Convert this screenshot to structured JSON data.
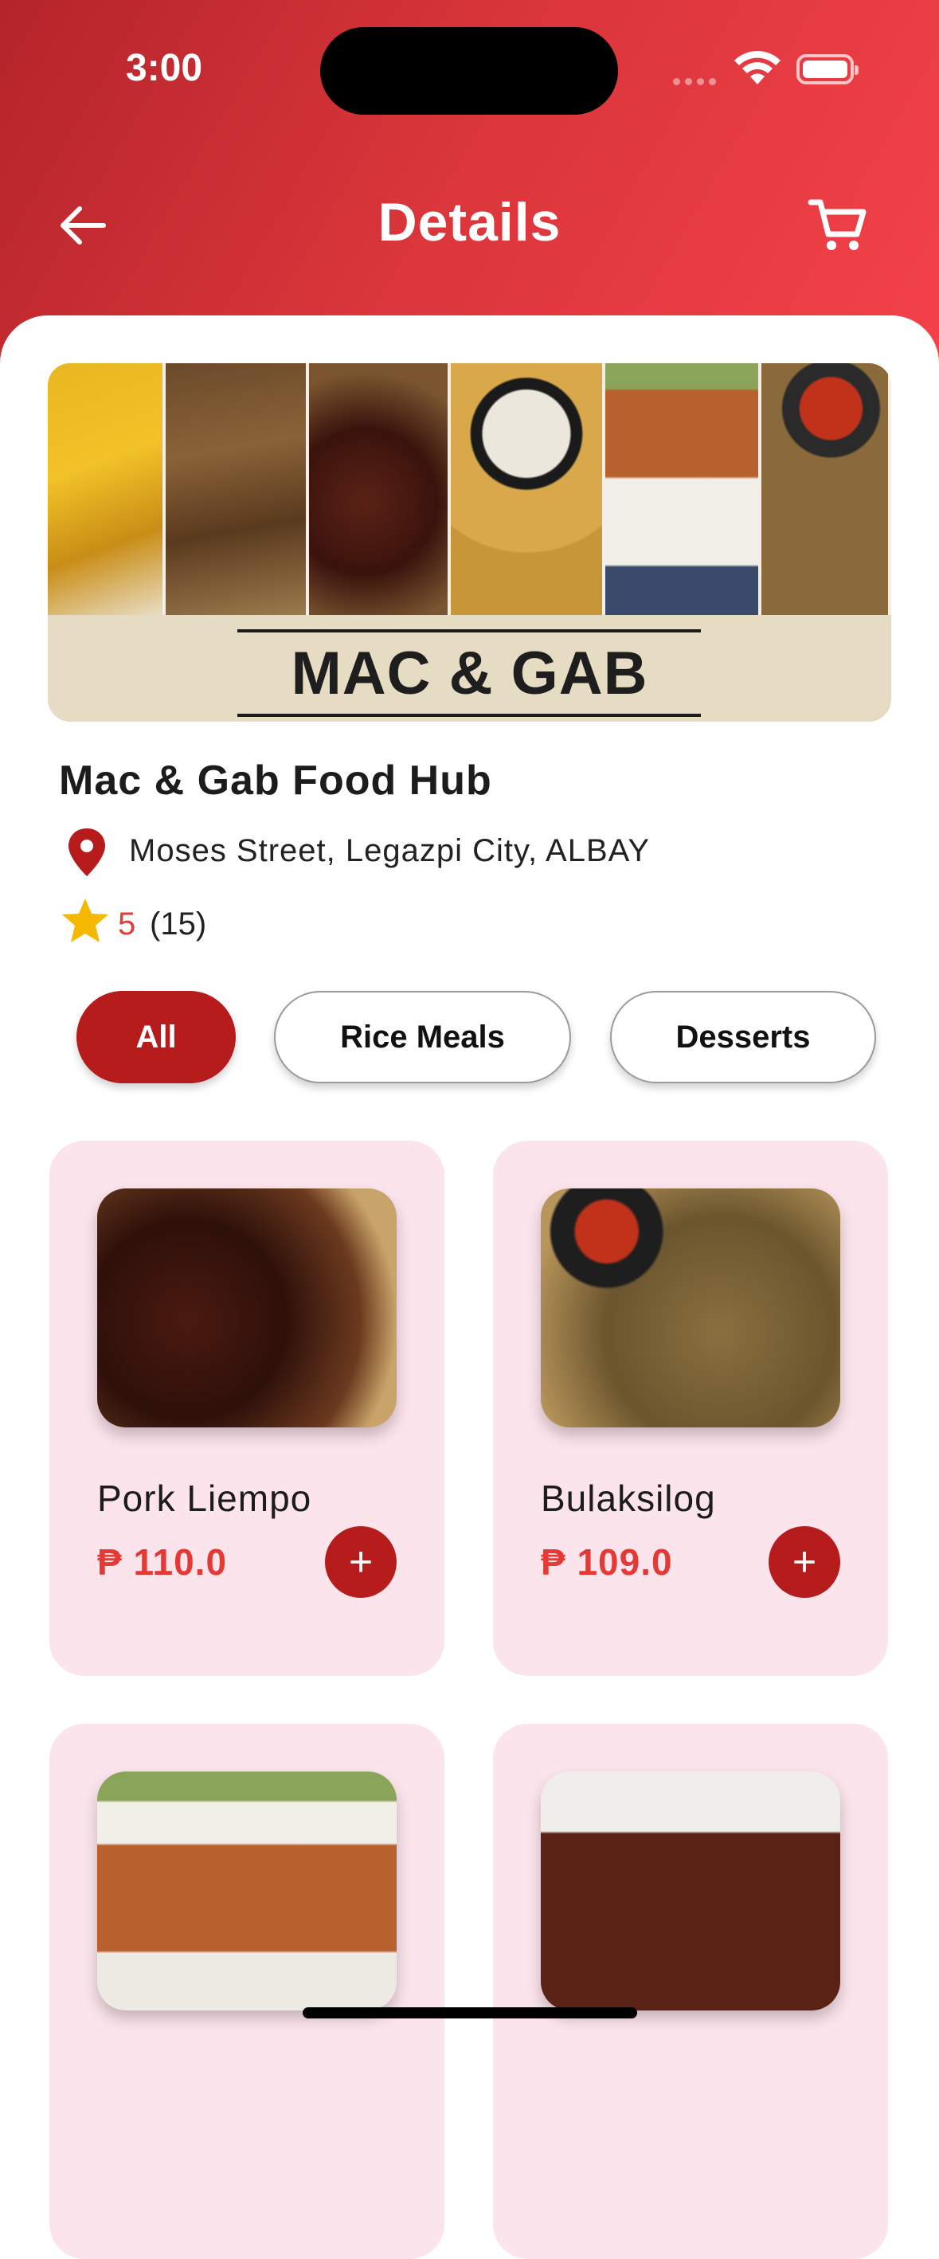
{
  "status_bar": {
    "time": "3:00"
  },
  "header": {
    "title": "Details"
  },
  "banner": {
    "brand_text": "MAC & GAB"
  },
  "store": {
    "name": "Mac & Gab Food Hub",
    "address": "Moses Street, Legazpi City, ALBAY",
    "rating": "5",
    "review_count": "(15)"
  },
  "categories": [
    {
      "label": "All",
      "active": true
    },
    {
      "label": "Rice Meals",
      "active": false
    },
    {
      "label": "Desserts",
      "active": false
    }
  ],
  "products": [
    {
      "name": "Pork Liempo",
      "price": "₱ 110.0"
    },
    {
      "name": "Bulaksilog",
      "price": "₱ 109.0"
    },
    {
      "name": "",
      "price": ""
    },
    {
      "name": "",
      "price": ""
    }
  ],
  "icons": {
    "back": "arrow-left-icon",
    "cart": "shopping-cart-icon",
    "location": "map-pin-icon",
    "rating": "star-icon",
    "add": "plus-icon"
  },
  "colors": {
    "header_start": "#b4242a",
    "header_end": "#f4414a",
    "accent": "#b71c1c",
    "price": "#e53935",
    "card_bg": "#fce4ec",
    "star": "#f5b800"
  }
}
